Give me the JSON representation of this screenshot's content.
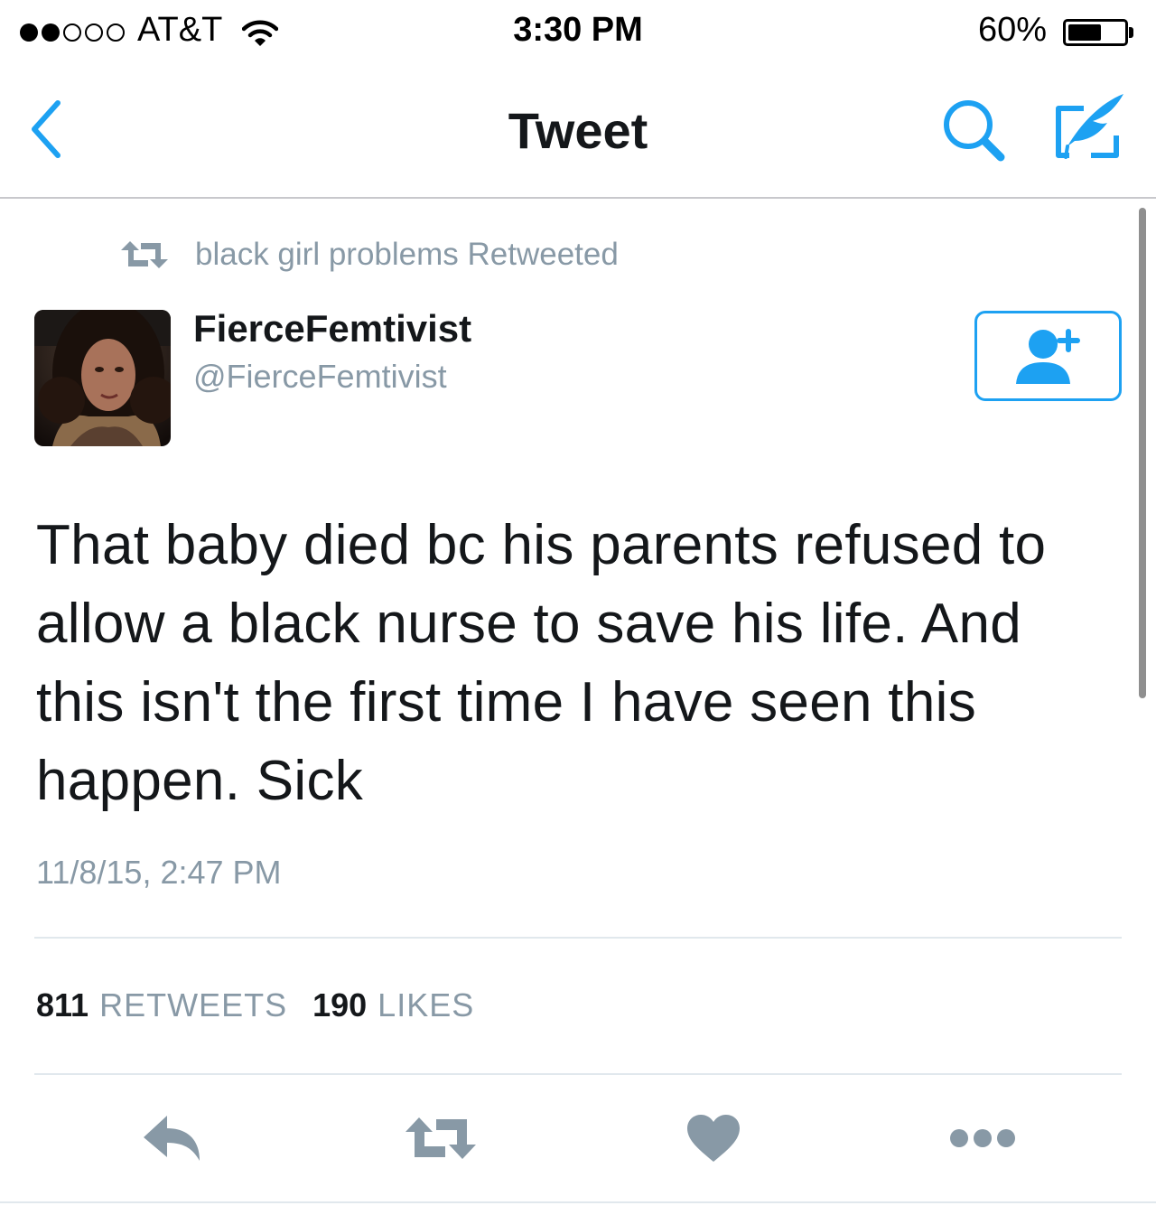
{
  "status_bar": {
    "carrier": "AT&T",
    "signal_bars_filled": 2,
    "signal_bars_total": 5,
    "time": "3:30 PM",
    "battery_percent": "60%",
    "battery_level": 0.6
  },
  "nav": {
    "title": "Tweet",
    "back_icon": "chevron-left-icon",
    "search_icon": "search-icon",
    "compose_icon": "compose-icon"
  },
  "tweet": {
    "retweet_context": "black girl problems Retweeted",
    "author": {
      "name": "FierceFemtivist",
      "handle": "@FierceFemtivist"
    },
    "text": "That baby died bc his parents refused to allow a black nurse to save his life. And this isn't the first time I have seen this happen. Sick",
    "timestamp": "11/8/15, 2:47 PM",
    "stats": {
      "retweets_count": "811",
      "retweets_label": "RETWEETS",
      "likes_count": "190",
      "likes_label": "LIKES"
    }
  },
  "colors": {
    "accent": "#1da1f2",
    "muted": "#8899a6",
    "text": "#14171a",
    "divider": "#e1e8ed"
  }
}
